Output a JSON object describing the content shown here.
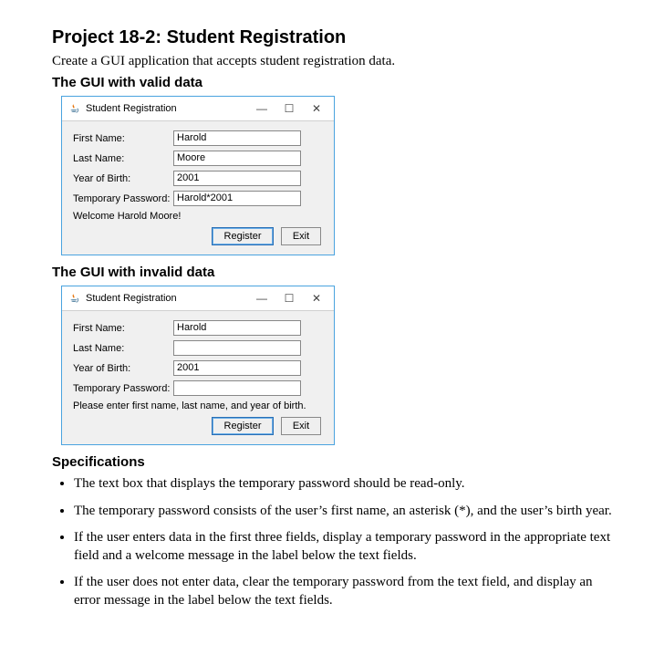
{
  "heading": "Project 18-2: Student Registration",
  "intro": "Create a GUI application that accepts student registration data.",
  "section_valid": "The GUI with valid data",
  "section_invalid": "The GUI with invalid data",
  "section_specs": "Specifications",
  "window": {
    "title": "Student Registration",
    "controls": {
      "min": "—",
      "max": "☐",
      "close": "✕"
    },
    "labels": {
      "first_name": "First Name:",
      "last_name": "Last Name:",
      "year_of_birth": "Year of Birth:",
      "temp_password": "Temporary Password:"
    },
    "buttons": {
      "register": "Register",
      "exit": "Exit"
    }
  },
  "valid": {
    "first_name": "Harold",
    "last_name": "Moore",
    "year_of_birth": "2001",
    "temp_password": "Harold*2001",
    "message": "Welcome Harold Moore!"
  },
  "invalid": {
    "first_name": "Harold",
    "last_name": "",
    "year_of_birth": "2001",
    "temp_password": "",
    "message": "Please enter first name, last name, and year of birth."
  },
  "specs": [
    "The text box that displays the temporary password should be read-only.",
    "The temporary password consists of the user’s first name, an asterisk (*), and the user’s birth year.",
    "If the user enters data in the first three fields, display a temporary password in the appropriate text field and a welcome message in the label below the text fields.",
    "If the user does not enter data, clear the temporary password from the text field, and display an error message in the label below the text fields."
  ]
}
